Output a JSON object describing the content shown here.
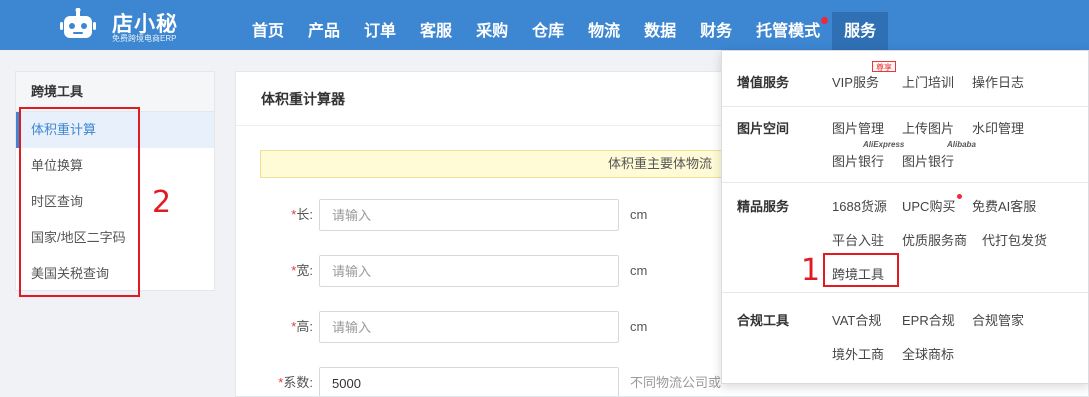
{
  "logo": {
    "title": "店小秘",
    "subtitle": "免费跨境电商ERP",
    "icon": "robot-icon"
  },
  "nav": [
    {
      "label": "首页"
    },
    {
      "label": "产品"
    },
    {
      "label": "订单"
    },
    {
      "label": "客服"
    },
    {
      "label": "采购"
    },
    {
      "label": "仓库"
    },
    {
      "label": "物流"
    },
    {
      "label": "数据"
    },
    {
      "label": "财务"
    },
    {
      "label": "托管模式",
      "dot": true
    },
    {
      "label": "服务",
      "active": true
    }
  ],
  "sidebar": {
    "title": "跨境工具",
    "items": [
      "体积重计算",
      "单位换算",
      "时区查询",
      "国家/地区二字码",
      "美国关税查询"
    ]
  },
  "main": {
    "title": "体积重计算器",
    "notice": "体积重主要体物流",
    "fields": [
      {
        "label": "长",
        "placeholder": "请输入",
        "value": "",
        "unit": "cm"
      },
      {
        "label": "宽",
        "placeholder": "请输入",
        "value": "",
        "unit": "cm"
      },
      {
        "label": "高",
        "placeholder": "请输入",
        "value": "",
        "unit": "cm"
      },
      {
        "label": "系数",
        "placeholder": "",
        "value": "5000",
        "unit": "不同物流公司或"
      }
    ]
  },
  "dropdown": {
    "sections": [
      {
        "title": "增值服务",
        "links": [
          "VIP服务",
          "上门培训",
          "操作日志"
        ],
        "badge": "尊享"
      },
      {
        "title": "图片空间",
        "links": [
          "图片管理",
          "上传图片",
          "水印管理",
          "图片银行",
          "图片银行"
        ],
        "brands": [
          "AliExpress",
          "Alibaba"
        ]
      },
      {
        "title": "精品服务",
        "links": [
          "1688货源",
          "UPC购买",
          "免费AI客服",
          "平台入驻",
          "优质服务商",
          "代打包发货",
          "跨境工具"
        ]
      },
      {
        "title": "合规工具",
        "links": [
          "VAT合规",
          "EPR合规",
          "合规管家",
          "境外工商",
          "全球商标"
        ]
      }
    ]
  },
  "annotations": {
    "one": "1",
    "two": "2"
  },
  "colors": {
    "brand": "#3d86d1",
    "highlight": "#e01b24"
  }
}
